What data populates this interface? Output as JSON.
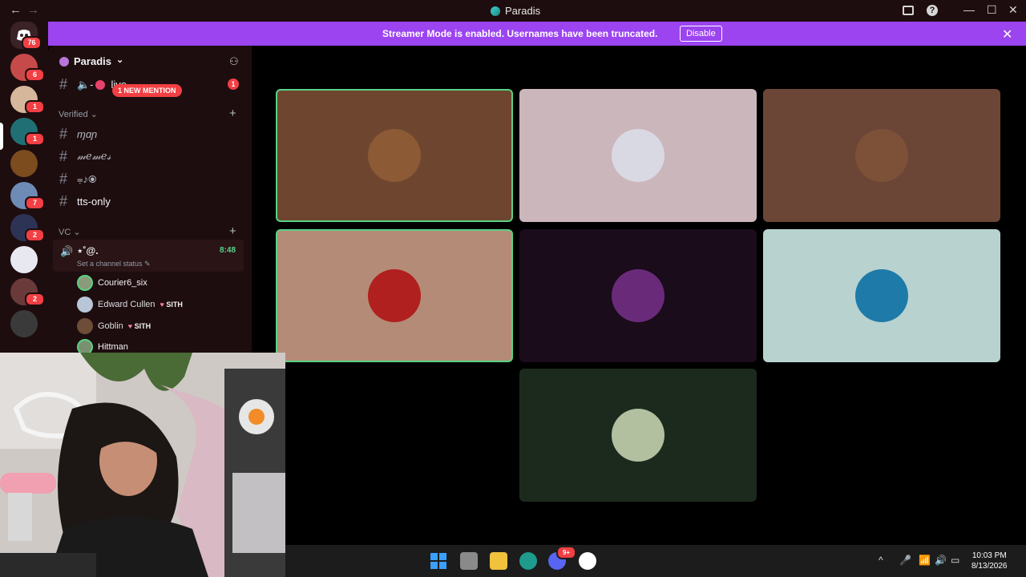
{
  "window": {
    "title": "Paradis",
    "back_glyph": "←",
    "forward_glyph": "→",
    "minimize_glyph": "—",
    "maximize_glyph": "☐",
    "close_glyph": "✕",
    "help_glyph": "?"
  },
  "rail": {
    "home_badge": "76",
    "servers": [
      {
        "badge": "6",
        "color": "#c74a4a"
      },
      {
        "badge": "1",
        "color": "#d6b79c"
      },
      {
        "badge": "1",
        "color": "#1f6f74"
      },
      {
        "badge": "",
        "color": "#7c4b1e"
      },
      {
        "badge": "7",
        "color": "#6d8bb5"
      },
      {
        "badge": "2",
        "color": "#2c3355"
      },
      {
        "badge": "",
        "color": "#e8e8f0"
      },
      {
        "badge": "2",
        "color": "#6a3a3a"
      },
      {
        "badge": "",
        "color": "#3a3a3a"
      }
    ]
  },
  "banner": {
    "text": "Streamer Mode is enabled. Usernames have been truncated.",
    "button": "Disable",
    "close_glyph": "✕"
  },
  "sidebar": {
    "server_name": "Paradis",
    "chevron": "⌄",
    "add_user_glyph": "⚇",
    "top_channel": {
      "name": "live",
      "prefix": "🔈-",
      "unread": "1"
    },
    "mention_pill": "1 NEW MENTION",
    "categories": {
      "verified": "Verified",
      "vc": "VC"
    },
    "channels": [
      {
        "name": "ɱɑɲ"
      },
      {
        "name": "𝓂𝑒𝓂𝑒𝓈"
      },
      {
        "name": "⩦♪⦿"
      },
      {
        "name": "tts-only"
      }
    ],
    "voice_channel": {
      "name": "⋆˚@.",
      "time": "8:48",
      "status": "Set a channel status ✎"
    },
    "members": [
      {
        "name": "Courier6_six",
        "tag": "",
        "color": "#8a9b7a"
      },
      {
        "name": "Edward Cullen",
        "tag": "SITH",
        "color": "#b8c6d8"
      },
      {
        "name": "Goblin",
        "tag": "SITH",
        "color": "#6d4d38"
      },
      {
        "name": "Hittman",
        "tag": "",
        "color": "#7a9070"
      }
    ]
  },
  "video_tiles": [
    {
      "bg": "#6e4630",
      "avatar": "#8c5a35",
      "speaking": true
    },
    {
      "bg": "#cbb6bc",
      "avatar": "#d9d9e3",
      "speaking": false
    },
    {
      "bg": "#6b4636",
      "avatar": "#7d5138",
      "speaking": false
    },
    {
      "bg": "#b48b76",
      "avatar": "#b0201e",
      "speaking": true
    },
    {
      "bg": "#1a0c1a",
      "avatar": "#6a2a7a",
      "speaking": false
    },
    {
      "bg": "#b8d2d0",
      "avatar": "#1e7aa8",
      "speaking": false
    },
    {
      "bg": "#1c2a1e",
      "avatar": "#b3c0a0",
      "speaking": false
    }
  ],
  "taskbar": {
    "discord_badge": "9+",
    "time": "10:03 PM",
    "date": "8/13/2026",
    "tray_up": "^"
  }
}
